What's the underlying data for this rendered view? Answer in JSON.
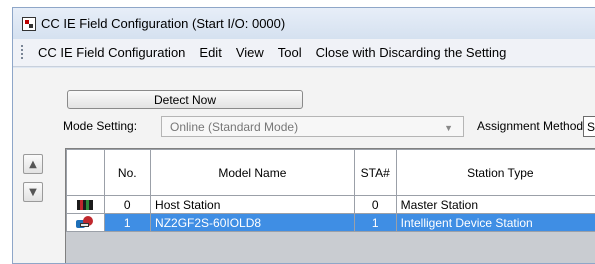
{
  "window": {
    "title": "CC IE Field Configuration (Start I/O: 0000)"
  },
  "menu": {
    "items": [
      "CC IE Field Configuration",
      "Edit",
      "View",
      "Tool",
      "Close with Discarding the Setting"
    ]
  },
  "toolbar": {
    "detect_label": "Detect Now",
    "mode_label": "Mode Setting:",
    "mode_value": "Online (Standard Mode)",
    "assign_label": "Assignment Method:",
    "assign_value": "Sta"
  },
  "icons": {
    "up": "up-arrow-icon",
    "down": "down-arrow-icon",
    "host": "host-station-icon",
    "device": "intelligent-device-icon"
  },
  "table": {
    "headers": [
      "",
      "No.",
      "Model Name",
      "STA#",
      "Station Type"
    ],
    "rows": [
      {
        "no": "0",
        "model": "Host Station",
        "sta": "0",
        "type": "Master Station",
        "selected": false
      },
      {
        "no": "1",
        "model": "NZ2GF2S-60IOLD8",
        "sta": "1",
        "type": "Intelligent Device Station",
        "selected": true
      }
    ]
  },
  "colors": {
    "selection": "#3f8ee4",
    "window_bg": "#dfe7f2",
    "grid_empty": "#c9ccd1"
  }
}
